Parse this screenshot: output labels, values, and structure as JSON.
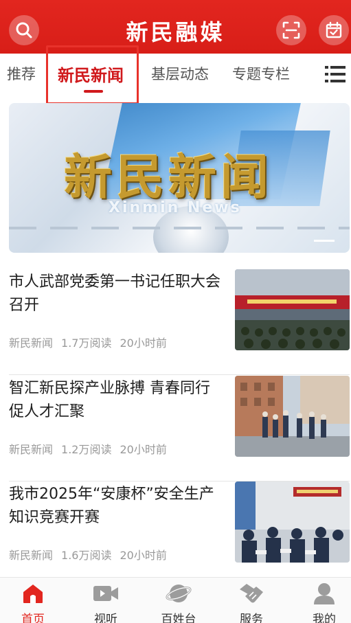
{
  "header": {
    "title": "新民融媒",
    "search_icon": "search-icon",
    "scan_icon": "scan-icon",
    "calendar_icon": "calendar-check-icon",
    "brand_color": "#e2261f"
  },
  "tabs": [
    {
      "label": "推荐"
    },
    {
      "label": "新民新闻",
      "active": true
    },
    {
      "label": "基层动态"
    },
    {
      "label": "专题专栏"
    }
  ],
  "tabs_menu_icon": "menu-icon",
  "banner": {
    "title": "新民新闻",
    "subtitle": "Xinmin News"
  },
  "news": [
    {
      "headline": "市人武部党委第一书记任职大会召开",
      "source": "新民新闻",
      "reads": "1.7万阅读",
      "time": "20小时前"
    },
    {
      "headline": "智汇新民探产业脉搏  青春同行促人才汇聚",
      "source": "新民新闻",
      "reads": "1.2万阅读",
      "time": "20小时前"
    },
    {
      "headline": "我市2025年“安康杯”安全生产知识竞赛开赛",
      "source": "新民新闻",
      "reads": "1.6万阅读",
      "time": "20小时前"
    }
  ],
  "bottom_nav": [
    {
      "label": "首页",
      "icon": "home-icon",
      "active": true
    },
    {
      "label": "视听",
      "icon": "video-icon"
    },
    {
      "label": "百姓台",
      "icon": "planet-icon"
    },
    {
      "label": "服务",
      "icon": "handshake-icon"
    },
    {
      "label": "我的",
      "icon": "user-icon"
    }
  ]
}
